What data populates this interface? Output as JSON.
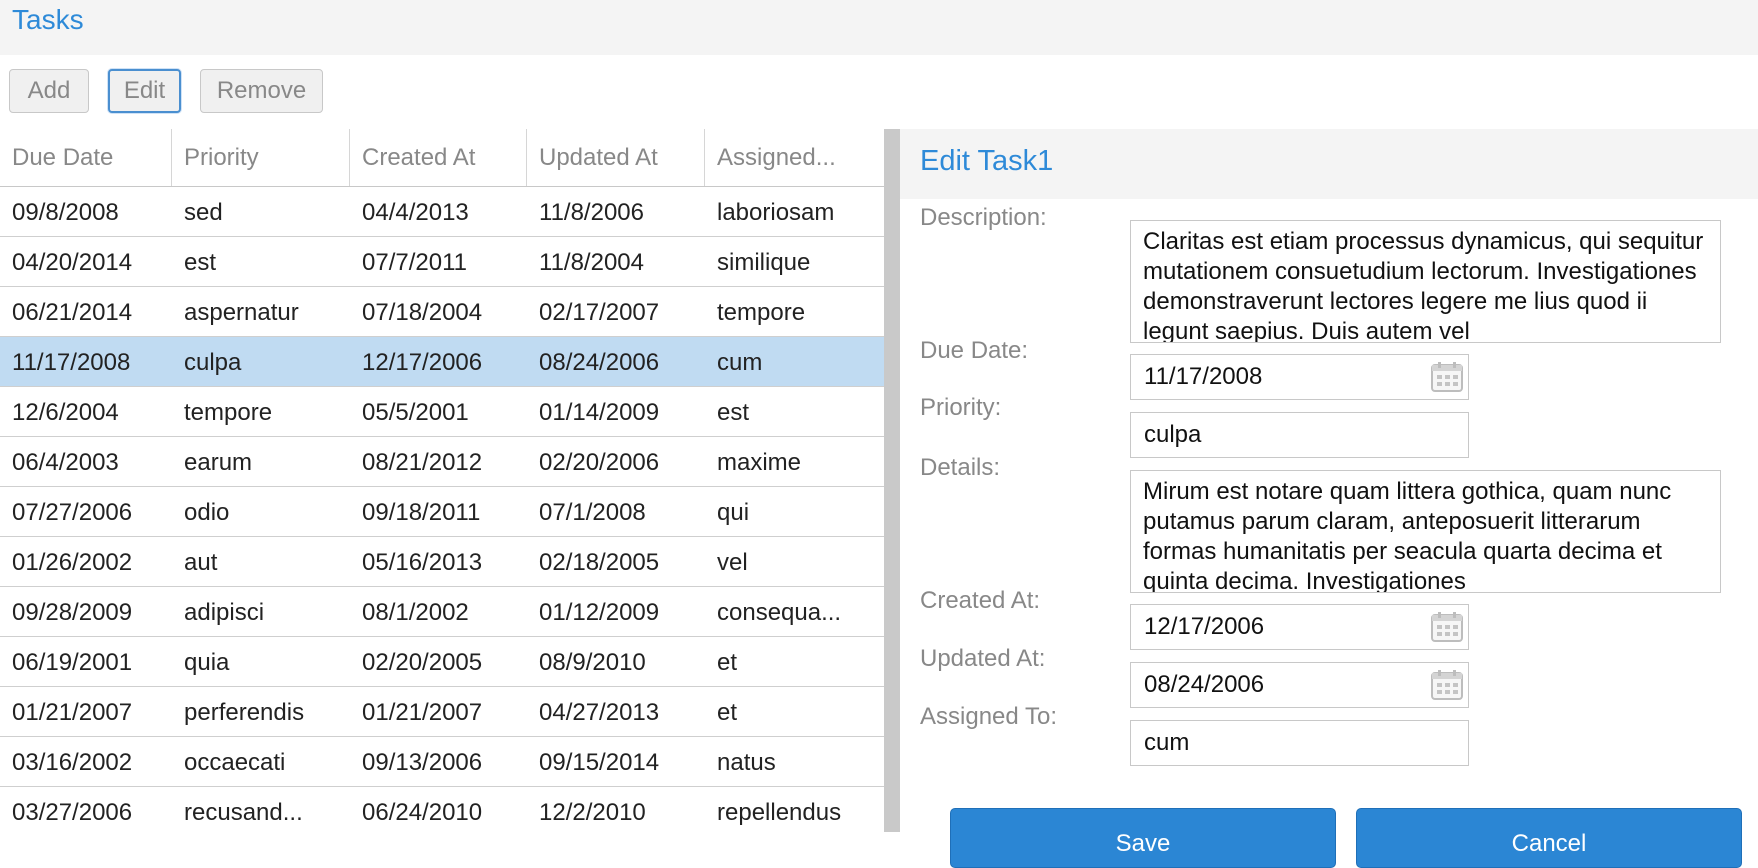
{
  "app": {
    "title": "Tasks"
  },
  "toolbar": {
    "add_label": "Add",
    "edit_label": "Edit",
    "remove_label": "Remove"
  },
  "grid": {
    "columns": [
      "Due Date",
      "Priority",
      "Created At",
      "Updated At",
      "Assigned..."
    ],
    "rows": [
      [
        "09/8/2008",
        "sed",
        "04/4/2013",
        "11/8/2006",
        "laboriosam"
      ],
      [
        "04/20/2014",
        "est",
        "07/7/2011",
        "11/8/2004",
        "similique"
      ],
      [
        "06/21/2014",
        "aspernatur",
        "07/18/2004",
        "02/17/2007",
        "tempore"
      ],
      [
        "11/17/2008",
        "culpa",
        "12/17/2006",
        "08/24/2006",
        "cum"
      ],
      [
        "12/6/2004",
        "tempore",
        "05/5/2001",
        "01/14/2009",
        "est"
      ],
      [
        "06/4/2003",
        "earum",
        "08/21/2012",
        "02/20/2006",
        "maxime"
      ],
      [
        "07/27/2006",
        "odio",
        "09/18/2011",
        "07/1/2008",
        "qui"
      ],
      [
        "01/26/2002",
        "aut",
        "05/16/2013",
        "02/18/2005",
        "vel"
      ],
      [
        "09/28/2009",
        "adipisci",
        "08/1/2002",
        "01/12/2009",
        "consequa..."
      ],
      [
        "06/19/2001",
        "quia",
        "02/20/2005",
        "08/9/2010",
        "et"
      ],
      [
        "01/21/2007",
        "perferendis",
        "01/21/2007",
        "04/27/2013",
        "et"
      ],
      [
        "03/16/2002",
        "occaecati",
        "09/13/2006",
        "09/15/2014",
        "natus"
      ],
      [
        "03/27/2006",
        "recusand...",
        "06/24/2010",
        "12/2/2010",
        "repellendus"
      ]
    ],
    "selected_row": 3
  },
  "editor": {
    "title": "Edit Task1",
    "description_label": "Description:",
    "description_value": "Claritas est etiam processus dynamicus, qui sequitur mutationem consuetudium lectorum. Investigationes demonstraverunt lectores legere me lius quod ii legunt saepius. Duis autem vel",
    "due_date_label": "Due Date:",
    "due_date_value": "11/17/2008",
    "priority_label": "Priority:",
    "priority_value": "culpa",
    "details_label": "Details:",
    "details_value": "Mirum est notare quam littera gothica, quam nunc putamus parum claram, anteposuerit litterarum formas humanitatis per seacula quarta decima et quinta decima. Investigationes",
    "created_at_label": "Created At:",
    "created_at_value": "12/17/2006",
    "updated_at_label": "Updated At:",
    "updated_at_value": "08/24/2006",
    "assigned_to_label": "Assigned To:",
    "assigned_to_value": "cum",
    "save_label": "Save",
    "cancel_label": "Cancel"
  },
  "icons": {
    "calendar": "calendar-icon"
  },
  "colors": {
    "accent": "#2e8ad8",
    "selected_row": "#c0dbf2",
    "primary_button": "#2b86d4"
  }
}
